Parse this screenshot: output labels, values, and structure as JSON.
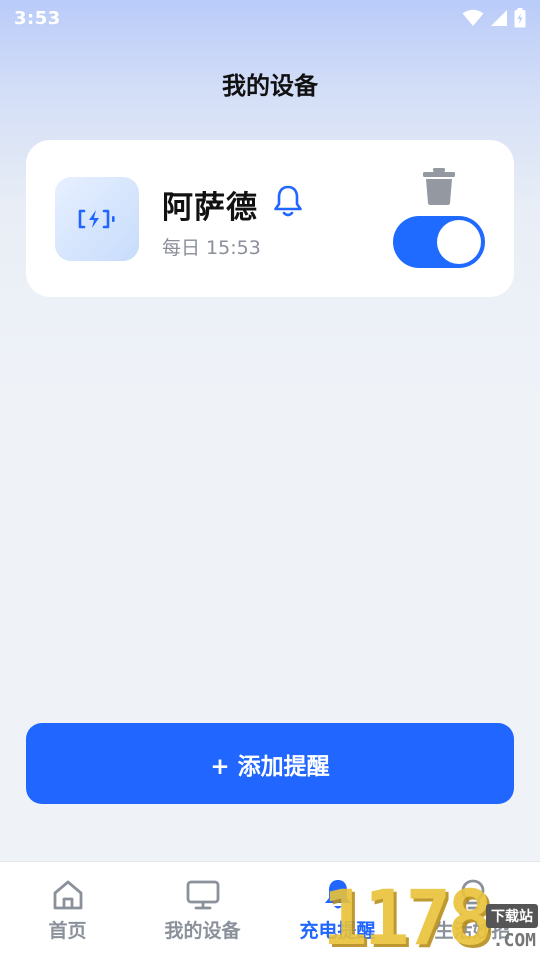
{
  "status_bar": {
    "time": "3:53",
    "icons": [
      "wifi-icon",
      "signal-icon",
      "battery-charging-icon"
    ]
  },
  "header": {
    "title": "我的设备"
  },
  "device_card": {
    "name": "阿萨德",
    "schedule": "每日 15:53",
    "icon": "battery-charging-icon",
    "reminder_icon": "bell-icon",
    "delete_icon": "trash-icon",
    "toggle_on": true
  },
  "add_button": {
    "label": "+ 添加提醒"
  },
  "bottom_nav": {
    "items": [
      {
        "label": "首页",
        "icon": "home-icon",
        "active": false
      },
      {
        "label": "我的设备",
        "icon": "monitor-icon",
        "active": false
      },
      {
        "label": "充电提醒",
        "icon": "bell-icon",
        "active": true
      },
      {
        "label": "生活妙招",
        "icon": "lightbulb-icon",
        "active": false
      }
    ]
  },
  "watermark": {
    "number": "1178",
    "site": "下载站",
    "domain": ".COM"
  },
  "colors": {
    "accent": "#2066ff",
    "inactive": "#8b919b",
    "card_bg": "#ffffff"
  }
}
